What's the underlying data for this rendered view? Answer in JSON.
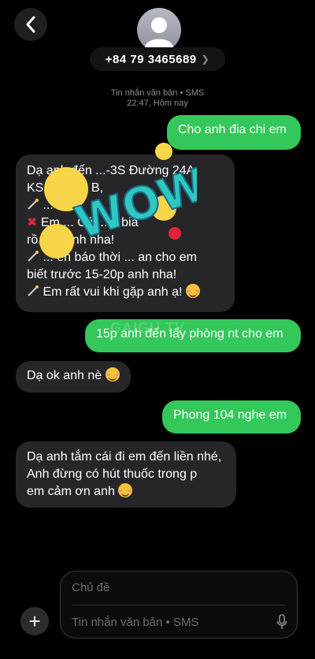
{
  "header": {
    "phone_number": "+84 79 3465689",
    "message_type": "Tin nhắn văn bản • SMS",
    "timestamp": "22:47, Hôm nay"
  },
  "messages": [
    {
      "direction": "outgoing",
      "text": "Cho anh đia chi em"
    },
    {
      "direction": "incoming",
      "lines": [
        "Dạ anh đến ...-3S Đường 24A",
        "KS... Đông B,",
        "... ac...",
        "Em ... Có ... u bia",
        "rồ... hi anh nha!",
        "... ến báo thời ... an cho em",
        "biết trước 15-20p anh nha!",
        "Em rất vui khi gặp anh ạ!"
      ]
    },
    {
      "direction": "outgoing",
      "text": "15p anh đến lấy phòng nt cho em"
    },
    {
      "direction": "incoming",
      "text": "Dạ ok anh nè"
    },
    {
      "direction": "outgoing",
      "text": "Phong 104 nghe em"
    },
    {
      "direction": "incoming",
      "lines": [
        "Dạ anh tắm cái đi em đến liền nhé,",
        "Anh đừng có hút thuốc trong p",
        "em cảm ơn anh"
      ]
    }
  ],
  "sticker_text": "WOW!!",
  "watermark": "GAIGU.TV",
  "compose": {
    "subject_placeholder": "Chủ đề",
    "message_placeholder": "Tin nhắn văn bản • SMS"
  },
  "icons": [
    "back-chevron-icon",
    "contact-avatar-icon",
    "chevron-right-icon",
    "plus-icon",
    "microphone-icon",
    "smiling-face-with-hearts-emoji",
    "magic-wand-emoji",
    "red-cross-emoji"
  ],
  "colors": {
    "outgoing_bubble": "#34c759",
    "incoming_bubble": "#262628",
    "background": "#000000"
  }
}
